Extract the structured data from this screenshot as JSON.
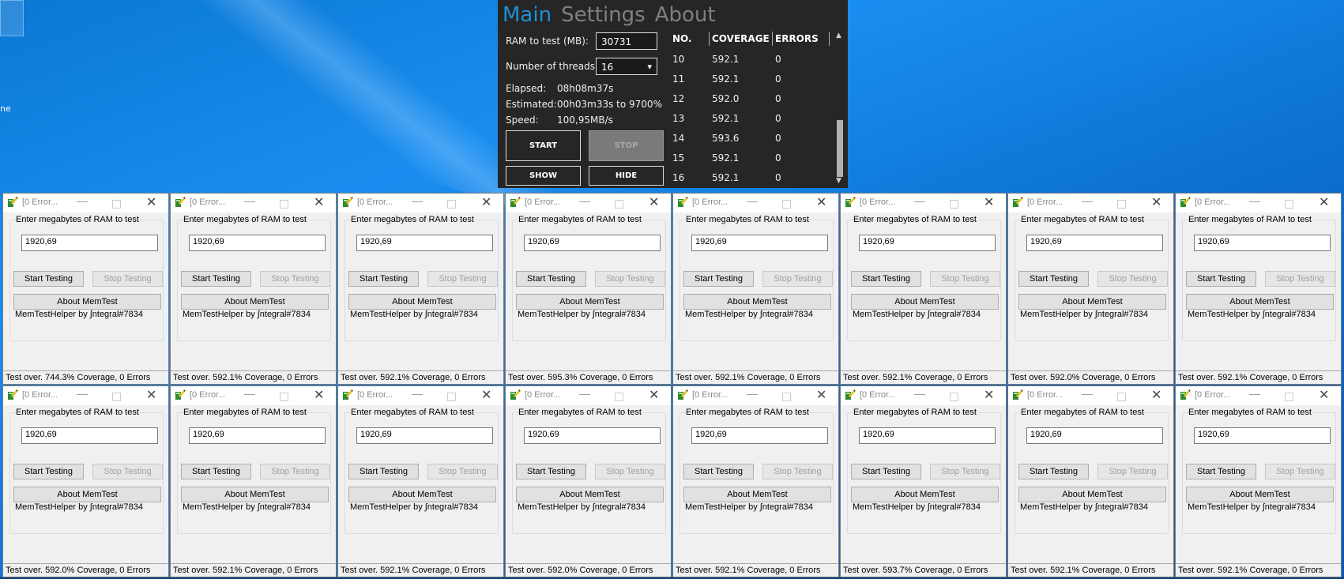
{
  "desktop": {
    "icon_label": "ne"
  },
  "memtest": {
    "nav": [
      "Main",
      "Settings",
      "About"
    ],
    "ram_label": "RAM to test (MB):",
    "ram_value": "30731",
    "threads_label": "Number of threads:",
    "threads_value": "16",
    "elapsed_label": "Elapsed:",
    "elapsed_value": "08h08m37s",
    "estimated_label": "Estimated:",
    "estimated_value": "00h03m33s to 9700%",
    "speed_label": "Speed:",
    "speed_value": "100,95MB/s",
    "start_label": "START",
    "stop_label": "STOP",
    "show_label": "SHOW",
    "hide_label": "HIDE",
    "columns": [
      "NO.",
      "COVERAGE",
      "ERRORS"
    ],
    "rows": [
      {
        "no": "10",
        "coverage": "592.1",
        "errors": "0"
      },
      {
        "no": "11",
        "coverage": "592.1",
        "errors": "0"
      },
      {
        "no": "12",
        "coverage": "592.0",
        "errors": "0"
      },
      {
        "no": "13",
        "coverage": "592.1",
        "errors": "0"
      },
      {
        "no": "14",
        "coverage": "593.6",
        "errors": "0"
      },
      {
        "no": "15",
        "coverage": "592.1",
        "errors": "0"
      },
      {
        "no": "16",
        "coverage": "592.1",
        "errors": "0"
      }
    ]
  },
  "helper": {
    "title": "[0 Error...",
    "prompt": "Enter megabytes of RAM to test",
    "ram_value": "1920,69",
    "start_label": "Start Testing",
    "stop_label": "Stop Testing",
    "about_label": "About MemTest",
    "credit": "MemTestHelper by ∫ntegral#7834"
  },
  "statuses": [
    "Test over. 744.3% Coverage, 0 Errors",
    "Test over. 592.1% Coverage, 0 Errors",
    "Test over. 592.1% Coverage, 0 Errors",
    "Test over. 595.3% Coverage, 0 Errors",
    "Test over. 592.1% Coverage, 0 Errors",
    "Test over. 592.1% Coverage, 0 Errors",
    "Test over. 592.0% Coverage, 0 Errors",
    "Test over. 592.1% Coverage, 0 Errors",
    "Test over. 592.0% Coverage, 0 Errors",
    "Test over. 592.1% Coverage, 0 Errors",
    "Test over. 592.1% Coverage, 0 Errors",
    "Test over. 592.0% Coverage, 0 Errors",
    "Test over. 592.1% Coverage, 0 Errors",
    "Test over. 593.7% Coverage, 0 Errors",
    "Test over. 592.1% Coverage, 0 Errors",
    "Test over. 592.1% Coverage, 0 Errors"
  ],
  "colors": {
    "desktop": "#0a78d4",
    "memtest_bg": "#262626",
    "nav_active": "#1e90d6",
    "nav_inactive": "#7f7f7f"
  }
}
